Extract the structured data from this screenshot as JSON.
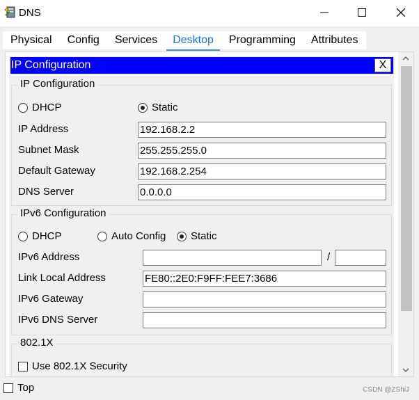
{
  "window": {
    "title": "DNS",
    "minimize_symbol": "—",
    "maximize_symbol": "☐",
    "close_symbol": "✕"
  },
  "tabs": [
    {
      "label": "Physical"
    },
    {
      "label": "Config"
    },
    {
      "label": "Services"
    },
    {
      "label": "Desktop",
      "active": true
    },
    {
      "label": "Programming"
    },
    {
      "label": "Attributes"
    }
  ],
  "ip_config": {
    "header_title": "IP Configuration",
    "close_label": "X",
    "ipv4": {
      "group_title": "IP Configuration",
      "dhcp_label": "DHCP",
      "static_label": "Static",
      "selected": "Static",
      "ip_address_label": "IP Address",
      "ip_address_value": "192.168.2.2",
      "subnet_mask_label": "Subnet Mask",
      "subnet_mask_value": "255.255.255.0",
      "gateway_label": "Default Gateway",
      "gateway_value": "192.168.2.254",
      "dns_label": "DNS Server",
      "dns_value": "0.0.0.0"
    },
    "ipv6": {
      "group_title": "IPv6 Configuration",
      "dhcp_label": "DHCP",
      "auto_label": "Auto Config",
      "static_label": "Static",
      "selected": "Static",
      "address_label": "IPv6 Address",
      "address_value": "",
      "prefix_separator": "/",
      "prefix_value": "",
      "link_local_label": "Link Local Address",
      "link_local_value": "FE80::2E0:F9FF:FEE7:3686",
      "gateway_label": "IPv6 Gateway",
      "gateway_value": "",
      "dns_label": "IPv6 DNS Server",
      "dns_value": ""
    },
    "dot1x": {
      "group_title": "802.1X",
      "use_security_label": "Use 802.1X Security",
      "use_security_checked": false
    }
  },
  "bottom": {
    "top_label": "Top",
    "top_checked": false,
    "watermark": "CSDN @ZShiJ"
  },
  "colors": {
    "header_bg": "#0000ff",
    "active_tab": "#1a73d9"
  }
}
